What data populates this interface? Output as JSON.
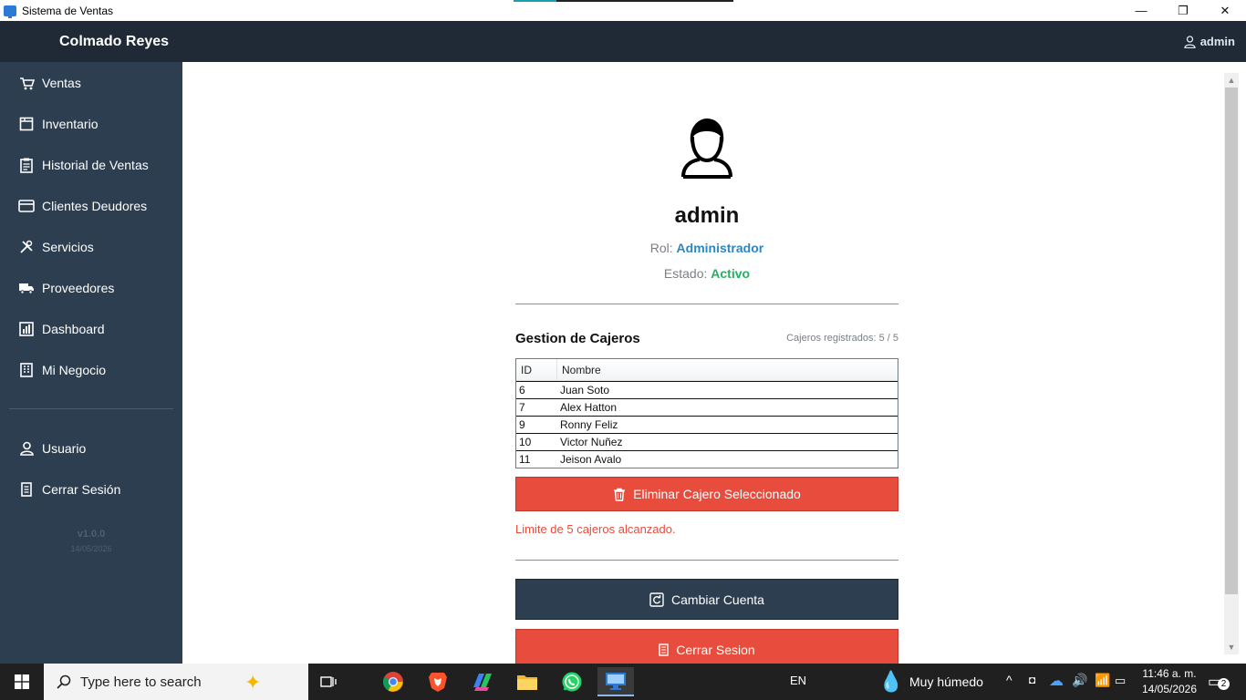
{
  "window": {
    "title": "Sistema de Ventas",
    "minimize": "—",
    "restore": "❐",
    "close": "✕"
  },
  "header": {
    "brand": "Colmado Reyes",
    "user": "admin"
  },
  "sidebar": {
    "items": [
      {
        "label": "Ventas",
        "icon": "cart-icon"
      },
      {
        "label": "Inventario",
        "icon": "box-icon"
      },
      {
        "label": "Historial de Ventas",
        "icon": "clipboard-icon"
      },
      {
        "label": "Clientes Deudores",
        "icon": "card-icon"
      },
      {
        "label": "Servicios",
        "icon": "tools-icon"
      },
      {
        "label": "Proveedores",
        "icon": "truck-icon"
      },
      {
        "label": "Dashboard",
        "icon": "chart-icon"
      },
      {
        "label": "Mi Negocio",
        "icon": "building-icon"
      }
    ],
    "bottom_items": [
      {
        "label": "Usuario",
        "icon": "user-icon"
      },
      {
        "label": "Cerrar Sesión",
        "icon": "door-icon"
      }
    ],
    "version": "v1.0.0",
    "date": "14/05/2026"
  },
  "profile": {
    "username": "admin",
    "role_label": "Rol: ",
    "role_value": "Administrador",
    "state_label": "Estado: ",
    "state_value": "Activo"
  },
  "cashiers": {
    "title": "Gestion de Cajeros",
    "count_text": "Cajeros registrados: 5 / 5",
    "columns": [
      "ID",
      "Nombre"
    ],
    "rows": [
      {
        "id": "6",
        "name": "Juan Soto"
      },
      {
        "id": "7",
        "name": "Alex Hatton"
      },
      {
        "id": "9",
        "name": "Ronny Feliz"
      },
      {
        "id": "10",
        "name": "Victor Nuñez"
      },
      {
        "id": "11",
        "name": "Jeison Avalo"
      }
    ],
    "delete_button": "Eliminar Cajero Seleccionado",
    "limit_message": "Limite de 5 cajeros alcanzado."
  },
  "actions": {
    "switch_account": "Cambiar Cuenta",
    "logout": "Cerrar Sesion"
  },
  "taskbar": {
    "search_placeholder": "Type here to search",
    "language": "EN",
    "weather": "Muy húmedo",
    "time": "11:46 a. m.",
    "date": "14/05/2026",
    "notifications": "2"
  },
  "colors": {
    "header_bg": "#1f2a36",
    "sidebar_bg": "#2c3e50",
    "danger": "#e74c3c",
    "role_blue": "#2e86c1",
    "active_green": "#27ae60"
  }
}
